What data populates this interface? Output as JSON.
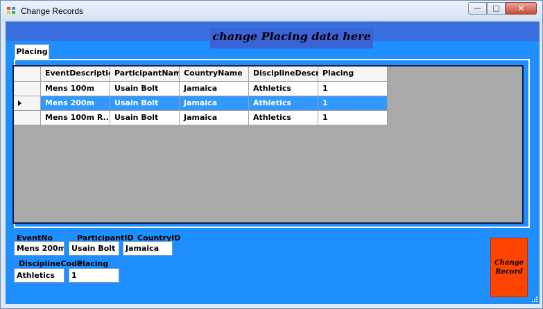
{
  "window": {
    "title": "Change Records"
  },
  "window_buttons": {
    "minimize": "—",
    "maximize": "□",
    "close": "✕"
  },
  "header": {
    "title": "change Placing data here"
  },
  "tab": {
    "label": "Placing"
  },
  "grid": {
    "columns": [
      "EventDescription",
      "ParticipantName",
      "CountryName",
      "DisciplineDescript",
      "Placing"
    ],
    "rows": [
      [
        "Mens 100m",
        "Usain Bolt",
        "Jamaica",
        "Athletics",
        "1"
      ],
      [
        "Mens 200m",
        "Usain Bolt",
        "Jamaica",
        "Athletics",
        "1"
      ],
      [
        "Mens 100m R...",
        "Usain Bolt",
        "Jamaica",
        "Athletics",
        "1"
      ]
    ],
    "selected_row": 1
  },
  "form": {
    "event_no": {
      "label": "EventNo",
      "value": "Mens 200m"
    },
    "participant_id": {
      "label": "ParticipantID",
      "value": "Usain Bolt"
    },
    "country_id": {
      "label": "CountryID",
      "value": "Jamaica"
    },
    "discipline_code": {
      "label": "DisciplineCode",
      "value": "Athletics"
    },
    "placing": {
      "label": "Placing",
      "value": "1"
    }
  },
  "change_button": {
    "label": "Change Record"
  },
  "colors": {
    "client_bg": "#1f8fff",
    "header_band": "#3a6fe0",
    "grid_bg": "#a9a9a9",
    "selection": "#3399ff",
    "button": "#ff4400"
  }
}
